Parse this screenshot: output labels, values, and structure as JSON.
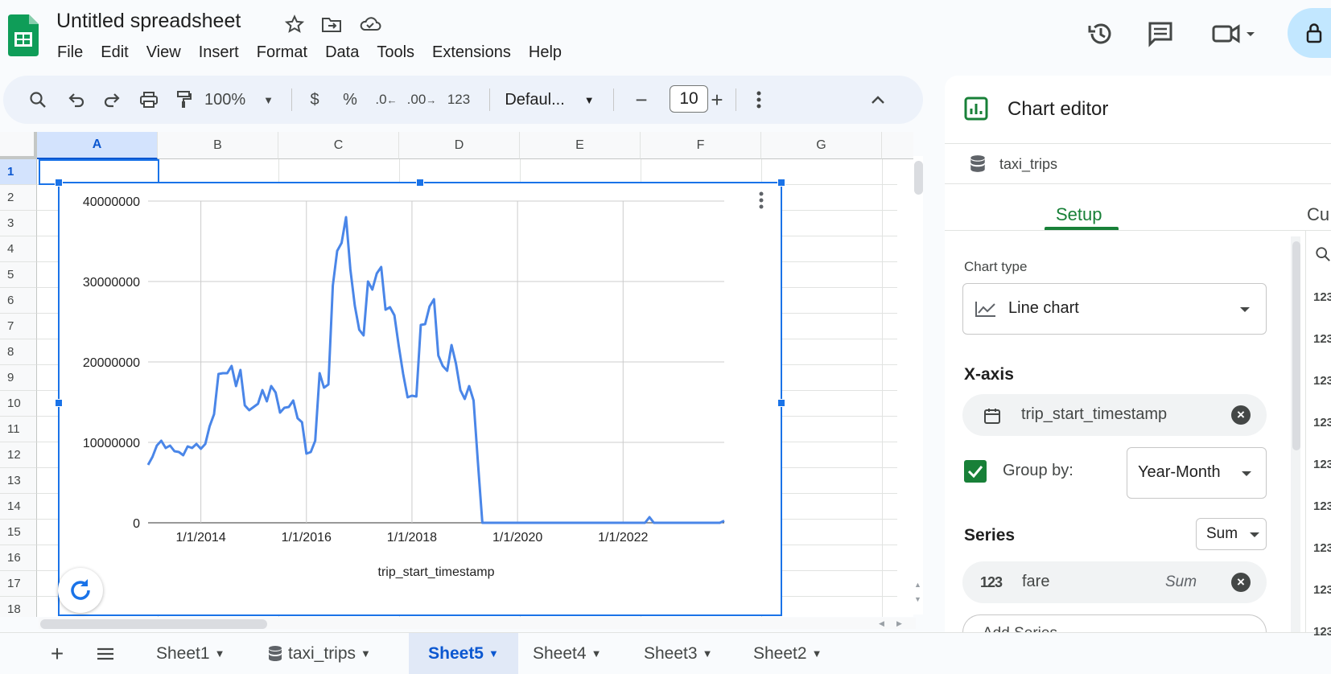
{
  "app": {
    "title": "Untitled spreadsheet",
    "menu": [
      "File",
      "Edit",
      "View",
      "Insert",
      "Format",
      "Data",
      "Tools",
      "Extensions",
      "Help"
    ]
  },
  "toolbar": {
    "zoom": "100%",
    "currency": "$",
    "percent": "%",
    "decrease_decimal": ".0",
    "increase_decimal": ".00",
    "number_format": "123",
    "font": "Defaul...",
    "font_size": "10",
    "minus": "−",
    "plus": "+"
  },
  "grid": {
    "columns": [
      "A",
      "B",
      "C",
      "D",
      "E",
      "F",
      "G"
    ],
    "rows": [
      "1",
      "2",
      "3",
      "4",
      "5",
      "6",
      "7",
      "8",
      "9",
      "10",
      "11",
      "12",
      "13",
      "14",
      "15",
      "16",
      "17",
      "18"
    ],
    "selected_cell": "A1"
  },
  "chart_data": {
    "type": "line",
    "xlabel": "trip_start_timestamp",
    "ylabel": "",
    "x_ticks": [
      "1/1/2014",
      "1/1/2016",
      "1/1/2018",
      "1/1/2020",
      "1/1/2022"
    ],
    "y_ticks": [
      "0",
      "10000000",
      "20000000",
      "30000000",
      "40000000"
    ],
    "ylim": [
      0,
      40000000
    ],
    "x_range": [
      "2013-01",
      "2023-12"
    ],
    "grid": true,
    "legend": "none",
    "series": [
      {
        "color": "#4a86e8",
        "points": [
          [
            "2013-01",
            7200000
          ],
          [
            "2013-02",
            8200000
          ],
          [
            "2013-03",
            9600000
          ],
          [
            "2013-04",
            10200000
          ],
          [
            "2013-05",
            9300000
          ],
          [
            "2013-06",
            9600000
          ],
          [
            "2013-07",
            8900000
          ],
          [
            "2013-08",
            8800000
          ],
          [
            "2013-09",
            8400000
          ],
          [
            "2013-10",
            9500000
          ],
          [
            "2013-11",
            9300000
          ],
          [
            "2013-12",
            9800000
          ],
          [
            "2014-01",
            9200000
          ],
          [
            "2014-02",
            9800000
          ],
          [
            "2014-03",
            12000000
          ],
          [
            "2014-04",
            13500000
          ],
          [
            "2014-05",
            18500000
          ],
          [
            "2014-06",
            18600000
          ],
          [
            "2014-07",
            18600000
          ],
          [
            "2014-08",
            19500000
          ],
          [
            "2014-09",
            17000000
          ],
          [
            "2014-10",
            19000000
          ],
          [
            "2014-11",
            14600000
          ],
          [
            "2014-12",
            14000000
          ],
          [
            "2015-01",
            14400000
          ],
          [
            "2015-02",
            14800000
          ],
          [
            "2015-03",
            16500000
          ],
          [
            "2015-04",
            15100000
          ],
          [
            "2015-05",
            17000000
          ],
          [
            "2015-06",
            16200000
          ],
          [
            "2015-07",
            13700000
          ],
          [
            "2015-08",
            14300000
          ],
          [
            "2015-09",
            14400000
          ],
          [
            "2015-10",
            15200000
          ],
          [
            "2015-11",
            13000000
          ],
          [
            "2015-12",
            12500000
          ],
          [
            "2016-01",
            8600000
          ],
          [
            "2016-02",
            8800000
          ],
          [
            "2016-03",
            10200000
          ],
          [
            "2016-04",
            18600000
          ],
          [
            "2016-05",
            16800000
          ],
          [
            "2016-06",
            17200000
          ],
          [
            "2016-07",
            29500000
          ],
          [
            "2016-08",
            33800000
          ],
          [
            "2016-09",
            34800000
          ],
          [
            "2016-10",
            38000000
          ],
          [
            "2016-11",
            31500000
          ],
          [
            "2016-12",
            27000000
          ],
          [
            "2017-01",
            24000000
          ],
          [
            "2017-02",
            23300000
          ],
          [
            "2017-03",
            30000000
          ],
          [
            "2017-04",
            29000000
          ],
          [
            "2017-05",
            31000000
          ],
          [
            "2017-06",
            31800000
          ],
          [
            "2017-07",
            26500000
          ],
          [
            "2017-08",
            26800000
          ],
          [
            "2017-09",
            25800000
          ],
          [
            "2017-10",
            22000000
          ],
          [
            "2017-11",
            18500000
          ],
          [
            "2017-12",
            15600000
          ],
          [
            "2018-01",
            15800000
          ],
          [
            "2018-02",
            15700000
          ],
          [
            "2018-03",
            24600000
          ],
          [
            "2018-04",
            24700000
          ],
          [
            "2018-05",
            26900000
          ],
          [
            "2018-06",
            27800000
          ],
          [
            "2018-07",
            20800000
          ],
          [
            "2018-08",
            19500000
          ],
          [
            "2018-09",
            18900000
          ],
          [
            "2018-10",
            22100000
          ],
          [
            "2018-11",
            19800000
          ],
          [
            "2018-12",
            16500000
          ],
          [
            "2019-01",
            15400000
          ],
          [
            "2019-02",
            17000000
          ],
          [
            "2019-03",
            15200000
          ],
          [
            "2019-04",
            7500000
          ],
          [
            "2019-05",
            0
          ],
          [
            "2020-01",
            0
          ],
          [
            "2021-01",
            0
          ],
          [
            "2022-01",
            0
          ],
          [
            "2022-06",
            0
          ],
          [
            "2022-07",
            700000
          ],
          [
            "2022-08",
            0
          ],
          [
            "2023-01",
            0
          ],
          [
            "2023-11",
            0
          ],
          [
            "2023-12",
            250000
          ]
        ]
      }
    ]
  },
  "sheets": {
    "add": "+",
    "list_icon": "list-icon",
    "tabs": [
      "Sheet1",
      "taxi_trips",
      "Sheet5",
      "Sheet4",
      "Sheet3",
      "Sheet2"
    ],
    "active": "Sheet5"
  },
  "editor": {
    "title": "Chart editor",
    "source": "taxi_trips",
    "tabs": {
      "setup": "Setup",
      "customize": "Cu"
    },
    "chart_type_label": "Chart type",
    "chart_type": "Line chart",
    "xaxis_label": "X-axis",
    "xaxis_field": "trip_start_timestamp",
    "group_by_label": "Group by:",
    "group_by_checked": true,
    "group_by_value": "Year-Month",
    "series_label": "Series",
    "series_agg": "Sum",
    "series_field": "fare",
    "series_field_agg": "Sum",
    "series_field_type": "123",
    "add_series": "Add Series",
    "side_list_icon": "123"
  },
  "colors": {
    "accent": "#1a73e8",
    "setup_tab": "#188038",
    "sheets_green": "#0f9d58",
    "checkbox": "#188038"
  }
}
